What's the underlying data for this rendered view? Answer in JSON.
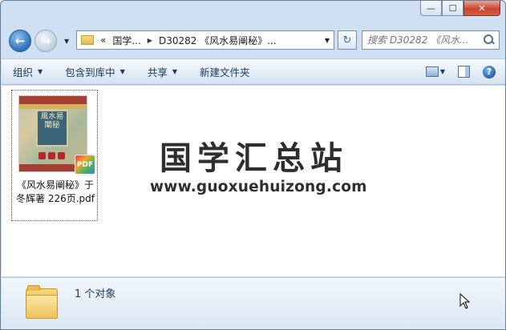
{
  "window": {
    "minimize_glyph": "—",
    "maximize_glyph": "☐",
    "close_glyph": "✕"
  },
  "nav": {
    "back_glyph": "←",
    "forward_glyph": "→",
    "history_arrow": "▼"
  },
  "address": {
    "overflow": "«",
    "segments": [
      "国学...",
      "D30282 《风水易阐秘》..."
    ],
    "separator": "▶",
    "dropdown_arrow": "▼",
    "refresh_glyph": "↻"
  },
  "search": {
    "placeholder": "搜索 D30282 《风水..."
  },
  "toolbar": {
    "organize": "组织",
    "include_in_library": "包含到库中",
    "share": "共享",
    "new_folder": "新建文件夹",
    "dropdown_arrow": "▼",
    "help_glyph": "?"
  },
  "files": [
    {
      "name": "《风水易阐秘》于冬辉著 226页.pdf",
      "thumbnail_title": "風水易闡秘",
      "badge": "PDF",
      "icon": "pdf-file-icon"
    }
  ],
  "watermark": {
    "text": "国学汇总站",
    "url": "www.guoxuehuizong.com"
  },
  "details": {
    "status": "1 个对象",
    "icon": "folder-icon"
  },
  "colors": {
    "frame": "#cfe0f3",
    "toolbar_text": "#1e395b",
    "close_button": "#c8452f",
    "book_cover_red": "#a43f35",
    "book_title_panel": "#3b6478"
  }
}
